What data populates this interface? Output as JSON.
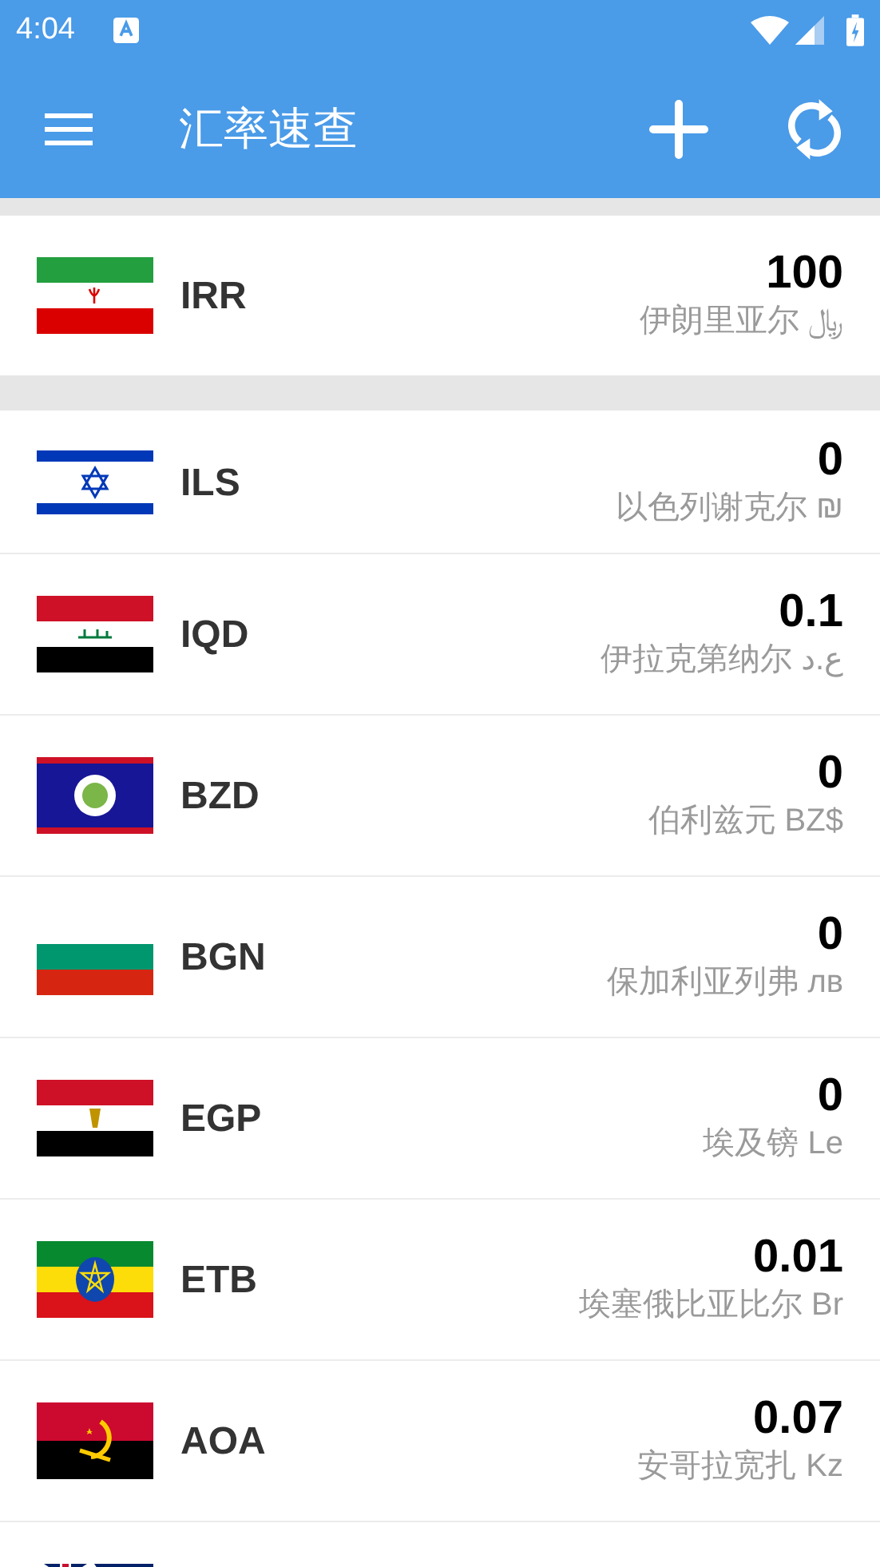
{
  "status_bar": {
    "time": "4:04"
  },
  "toolbar": {
    "title": "汇率速查"
  },
  "base": {
    "kind": "ir",
    "code": "IRR",
    "amount": "100",
    "name": "伊朗里亚尔 ﷼"
  },
  "rows": [
    {
      "kind": "il",
      "code": "ILS",
      "amount": "0",
      "name": "以色列谢克尔 ₪"
    },
    {
      "kind": "iq",
      "code": "IQD",
      "amount": "0.1",
      "name": "伊拉克第纳尔 ع.د"
    },
    {
      "kind": "bz",
      "code": "BZD",
      "amount": "0",
      "name": "伯利兹元 BZ$"
    },
    {
      "kind": "bg",
      "code": "BGN",
      "amount": "0",
      "name": "保加利亚列弗 лв"
    },
    {
      "kind": "eg",
      "code": "EGP",
      "amount": "0",
      "name": "埃及镑 Le"
    },
    {
      "kind": "et",
      "code": "ETB",
      "amount": "0.01",
      "name": "埃塞俄比亚比尔 Br"
    },
    {
      "kind": "ao",
      "code": "AOA",
      "amount": "0.07",
      "name": "安哥拉宽扎 Kz"
    },
    {
      "kind": "au"
    }
  ]
}
